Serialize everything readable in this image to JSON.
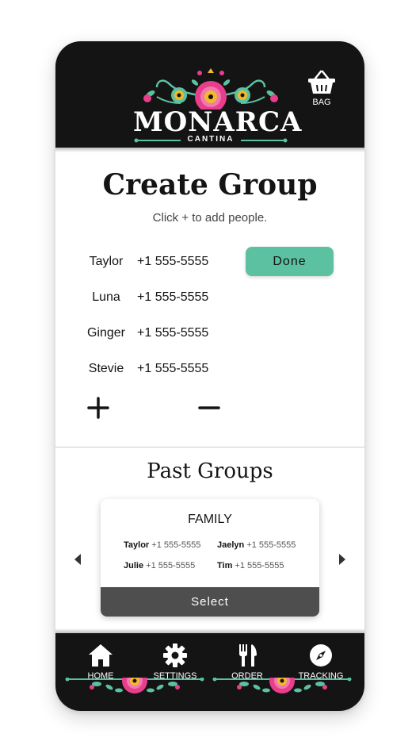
{
  "brand": {
    "name": "MONARCA",
    "subtitle": "CANTINA"
  },
  "header": {
    "bag_label": "BAG"
  },
  "create_group": {
    "title": "Create Group",
    "hint": "Click + to add people.",
    "done_label": "Done",
    "members": [
      {
        "name": "Taylor",
        "phone": "+1 555-5555"
      },
      {
        "name": "Luna",
        "phone": "+1 555-5555"
      },
      {
        "name": "Ginger",
        "phone": "+1 555-5555"
      },
      {
        "name": "Stevie",
        "phone": "+1 555-5555"
      }
    ]
  },
  "past_groups": {
    "title": "Past Groups",
    "cards": [
      {
        "title": "FAMILY",
        "members": [
          {
            "name": "Taylor",
            "phone": "+1 555-5555"
          },
          {
            "name": "Jaelyn",
            "phone": "+1 555-5555"
          },
          {
            "name": "Julie",
            "phone": "+1 555-5555"
          },
          {
            "name": "Tim",
            "phone": "+1 555-5555"
          }
        ],
        "select_label": "Select"
      }
    ]
  },
  "nav": {
    "items": [
      {
        "label": "HOME",
        "icon": "home-icon"
      },
      {
        "label": "SETTINGS",
        "icon": "gear-icon"
      },
      {
        "label": "ORDER",
        "icon": "fork-knife-icon"
      },
      {
        "label": "TRACKING",
        "icon": "compass-icon"
      }
    ]
  },
  "colors": {
    "header_bg": "#141414",
    "accent_teal": "#5bc1a1",
    "accent_pink": "#e83e8c",
    "accent_yellow": "#f5b928",
    "select_bg": "#4e4e4e"
  }
}
